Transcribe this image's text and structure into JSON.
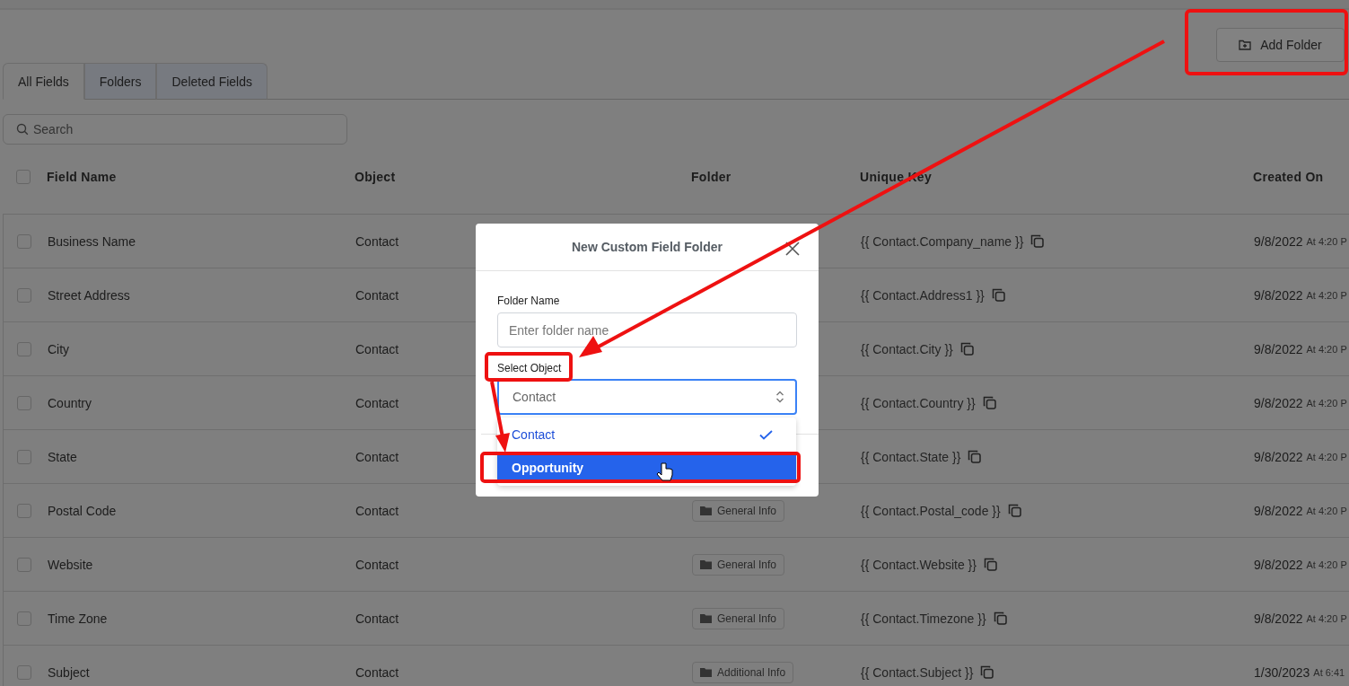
{
  "header": {
    "add_folder_button": "Add Folder"
  },
  "tabs": [
    {
      "label": "All Fields",
      "selected": true
    },
    {
      "label": "Folders",
      "selected": false
    },
    {
      "label": "Deleted Fields",
      "selected": false
    }
  ],
  "search": {
    "placeholder": "Search"
  },
  "table": {
    "select_all_checked": false,
    "columns": [
      "Field Name",
      "Object",
      "Folder",
      "Unique Key",
      "Created On"
    ],
    "rows": [
      {
        "checked": false,
        "field_name": "Business Name",
        "object": "Contact",
        "unique_key": "{{ Contact.Company_name }}",
        "date": "9/8/2022",
        "time": "At 4:20 P"
      },
      {
        "checked": false,
        "field_name": "Street Address",
        "object": "Contact",
        "unique_key": "{{ Contact.Address1 }}",
        "date": "9/8/2022",
        "time": "At 4:20 P"
      },
      {
        "checked": false,
        "field_name": "City",
        "object": "Contact",
        "unique_key": "{{ Contact.City }}",
        "date": "9/8/2022",
        "time": "At 4:20 P"
      },
      {
        "checked": false,
        "field_name": "Country",
        "object": "Contact",
        "unique_key": "{{ Contact.Country }}",
        "date": "9/8/2022",
        "time": "At 4:20 P"
      },
      {
        "checked": false,
        "field_name": "State",
        "object": "Contact",
        "unique_key": "{{ Contact.State }}",
        "date": "9/8/2022",
        "time": "At 4:20 P"
      },
      {
        "checked": false,
        "field_name": "Postal Code",
        "object": "Contact",
        "folder": "General Info",
        "unique_key": "{{ Contact.Postal_code }}",
        "date": "9/8/2022",
        "time": "At 4:20 P"
      },
      {
        "checked": false,
        "field_name": "Website",
        "object": "Contact",
        "folder": "General Info",
        "unique_key": "{{ Contact.Website }}",
        "date": "9/8/2022",
        "time": "At 4:20 P"
      },
      {
        "checked": false,
        "field_name": "Time Zone",
        "object": "Contact",
        "folder": "General Info",
        "unique_key": "{{ Contact.Timezone }}",
        "date": "9/8/2022",
        "time": "At 4:20 P"
      },
      {
        "checked": false,
        "field_name": "Subject",
        "object": "Contact",
        "folder": "Additional Info",
        "unique_key": "{{ Contact.Subject }}",
        "date": "1/30/2023",
        "time": "At 6:41"
      }
    ]
  },
  "dialog": {
    "title": "New Custom Field Folder",
    "folder_name": {
      "label": "Folder Name",
      "placeholder": "Enter folder name"
    },
    "select_object": {
      "label": "Select Object",
      "value": "Contact",
      "options": [
        {
          "label": "Contact",
          "selected": true,
          "highlighted": false
        },
        {
          "label": "Opportunity",
          "selected": false,
          "highlighted": true
        }
      ]
    }
  }
}
